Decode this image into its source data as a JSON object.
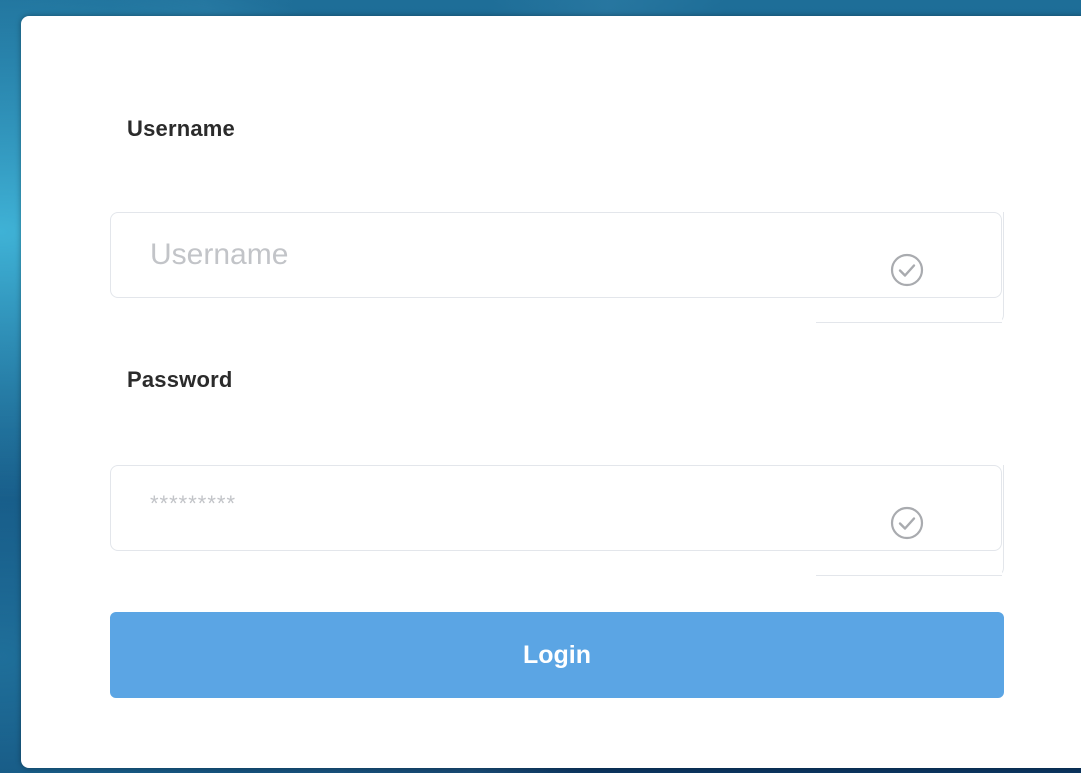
{
  "form": {
    "username": {
      "label": "Username",
      "placeholder": "Username",
      "icon": "check-circle-icon"
    },
    "password": {
      "label": "Password",
      "placeholder": "*********",
      "icon": "check-circle-icon"
    },
    "login_label": "Login"
  },
  "colors": {
    "button": "#5ba5e4",
    "button_text": "#ffffff",
    "placeholder": "#c2c4c8",
    "label": "#2b2b2b",
    "border": "#e3e6eb"
  }
}
